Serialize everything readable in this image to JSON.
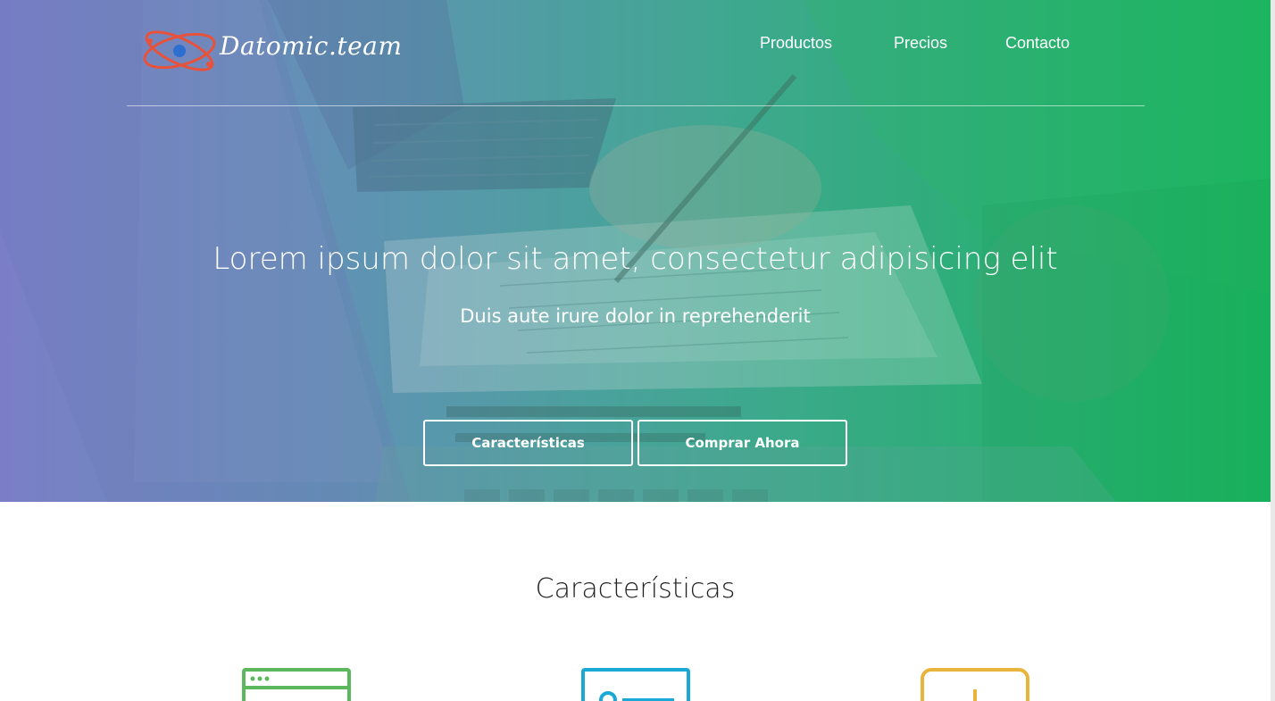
{
  "brand": {
    "name": "Datomic.team"
  },
  "nav": {
    "items": [
      {
        "label": "Productos"
      },
      {
        "label": "Precios"
      },
      {
        "label": "Contacto"
      }
    ]
  },
  "hero": {
    "title": "Lorem ipsum dolor sit amet, consectetur adipisicing elit",
    "subtitle": "Duis aute irure dolor in reprehenderit",
    "buttons": [
      {
        "label": "Características"
      },
      {
        "label": "Comprar Ahora"
      }
    ]
  },
  "features": {
    "title": "Características",
    "icons": [
      {
        "name": "browser-window-icon",
        "color": "#5cb85c"
      },
      {
        "name": "id-card-icon",
        "color": "#1ba8d6"
      },
      {
        "name": "document-download-icon",
        "color": "#e8b43c"
      }
    ]
  },
  "colors": {
    "gradient_start": "#7e86c6",
    "gradient_end": "#1fb561",
    "logo_accent": "#e8523a",
    "logo_blue": "#2c6fd1"
  }
}
